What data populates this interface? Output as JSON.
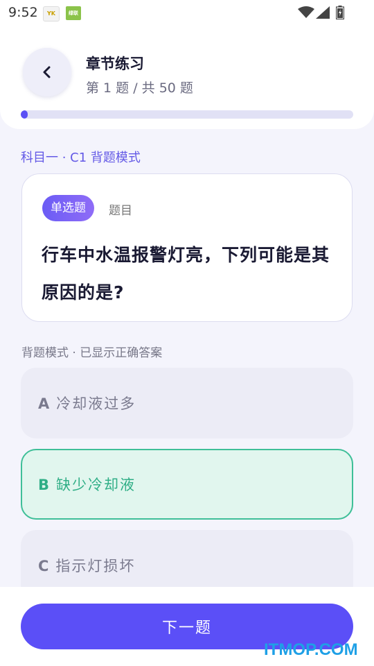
{
  "status_bar": {
    "time": "9:52",
    "app1_label": "YK",
    "app2_label": "绿联"
  },
  "header": {
    "title": "章节练习",
    "subtitle": "第 1 题 / 共 50 题",
    "progress_fraction": 0.02
  },
  "mode_label": "科目一 · C1 背题模式",
  "question": {
    "badge": "单选题",
    "badge_aside": "题目",
    "text": "行车中水温报警灯亮，下列可能是其原因的是?"
  },
  "hint": "背题模式 · 已显示正确答案",
  "options": [
    {
      "letter": "A",
      "text": "冷却液过多",
      "state": "normal"
    },
    {
      "letter": "B",
      "text": "缺少冷却液",
      "state": "correct"
    },
    {
      "letter": "C",
      "text": "指示灯损坏",
      "state": "normal"
    }
  ],
  "next_button_label": "下一题",
  "watermark": "ITMOP.COM",
  "colors": {
    "accent": "#5b4ff7",
    "correct": "#3fbf98",
    "correct_bg": "#e1f6ee"
  },
  "icons": {
    "back": "chevron-left-icon"
  }
}
